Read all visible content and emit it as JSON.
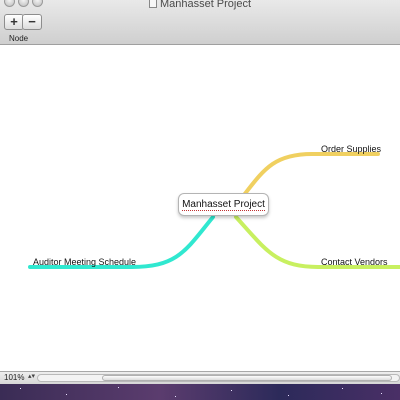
{
  "window": {
    "title": "Manhasset Project"
  },
  "toolbar": {
    "add_label": "+",
    "remove_label": "−",
    "group_label": "Node"
  },
  "mindmap": {
    "central": "Manhasset Project",
    "branches": [
      {
        "label": "Order Supplies",
        "color": "#f0d060"
      },
      {
        "label": "Contact Vendors",
        "color": "#c8f060"
      },
      {
        "label": "Auditor Meeting Schedule",
        "color": "#30e8d0"
      }
    ]
  },
  "statusbar": {
    "zoom": "101%",
    "zoom_arrows": "▴▾"
  },
  "colors": {
    "order_supplies_branch": "#f0d060",
    "contact_vendors_branch": "#c8f060",
    "auditor_branch": "#30e8d0"
  }
}
